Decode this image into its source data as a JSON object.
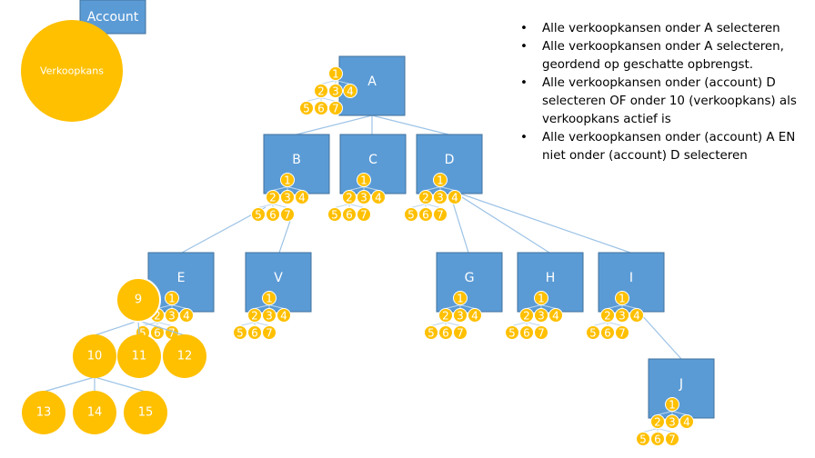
{
  "legend": {
    "account_label": "Account",
    "opportunity_label": "Verkoopkans"
  },
  "colors": {
    "account": "#5b9bd5",
    "account_border": "#41719c",
    "opportunity": "#ffc000",
    "edge": "#9dc3e6",
    "text_light": "#ffffff"
  },
  "accounts": [
    {
      "id": "A",
      "label": "A",
      "parent": null
    },
    {
      "id": "B",
      "label": "B",
      "parent": "A"
    },
    {
      "id": "C",
      "label": "C",
      "parent": "A"
    },
    {
      "id": "D",
      "label": "D",
      "parent": "A"
    },
    {
      "id": "E",
      "label": "E",
      "parent": "B"
    },
    {
      "id": "V",
      "label": "V",
      "parent": "B"
    },
    {
      "id": "G",
      "label": "G",
      "parent": "D"
    },
    {
      "id": "H",
      "label": "H",
      "parent": "D"
    },
    {
      "id": "I",
      "label": "I",
      "parent": "D"
    },
    {
      "id": "J",
      "label": "J",
      "parent": "I"
    }
  ],
  "opportunity_subtree": {
    "labels": [
      "1",
      "2",
      "3",
      "4",
      "5",
      "6",
      "7"
    ],
    "edges": [
      [
        "1",
        "2"
      ],
      [
        "1",
        "3"
      ],
      [
        "1",
        "4"
      ],
      [
        "2",
        "5"
      ],
      [
        "2",
        "6"
      ],
      [
        "2",
        "7"
      ]
    ]
  },
  "large_opportunity_tree": {
    "nodes": [
      "9",
      "10",
      "11",
      "12",
      "13",
      "14",
      "15"
    ],
    "edges": [
      [
        "9",
        "10"
      ],
      [
        "9",
        "11"
      ],
      [
        "9",
        "12"
      ],
      [
        "10",
        "13"
      ],
      [
        "10",
        "14"
      ],
      [
        "10",
        "15"
      ]
    ]
  },
  "bullets": [
    "Alle verkoopkansen onder A selecteren",
    "Alle verkoopkansen onder A selecteren, geordend op geschatte opbrengst.",
    "Alle verkoopkansen onder (account) D selecteren OF onder 10 (verkoopkans) als verkoopkans actief is",
    "Alle verkoopkansen onder (account) A EN niet onder (account) D selecteren"
  ]
}
